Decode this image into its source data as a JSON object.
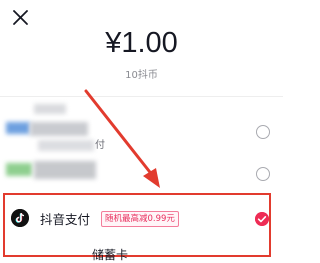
{
  "header": {
    "close_icon": "close-icon",
    "price": "¥1.00",
    "sub": "10抖币"
  },
  "payment_methods": [
    {
      "label": "付",
      "blurred": true,
      "selected": false
    },
    {
      "label": "",
      "blurred": true,
      "selected": false
    },
    {
      "label": "抖音支付",
      "promo": "随机最高减0.99元",
      "icon": "tiktok-logo-icon",
      "selected": true,
      "highlighted": true
    },
    {
      "label": "储蓄卡",
      "partially_visible": true
    }
  ],
  "colors": {
    "highlight_box": "#e23b2e",
    "selected_check": "#ee2c55",
    "promo_text": "#e8315f",
    "arrow": "#e23b2e"
  }
}
